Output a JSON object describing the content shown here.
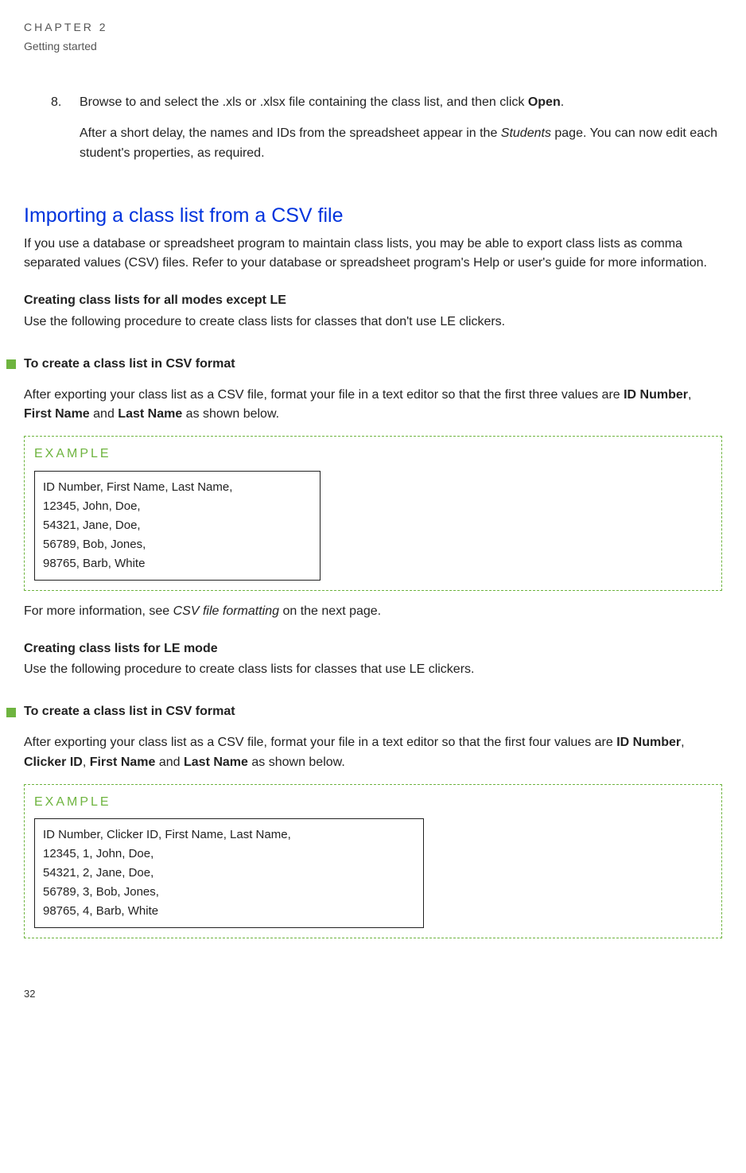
{
  "header": {
    "chapter": "CHAPTER 2",
    "subtitle": "Getting started"
  },
  "step8": {
    "number": "8.",
    "line1_pre": "Browse to and select the .xls or .xlsx file containing the class list, and then click ",
    "line1_bold": "Open",
    "line1_post": ".",
    "line2_pre": "After a short delay, the names and IDs from the spreadsheet appear in the ",
    "line2_italic": "Students",
    "line2_post": " page. You can now edit each student's properties, as required."
  },
  "section_title": "Importing a class list from a CSV file",
  "section_intro": "If you use a database or spreadsheet program to maintain class lists, you may be able to export class lists as comma separated values (CSV) files. Refer to your database or spreadsheet program's Help or user's guide for more information.",
  "sub1": {
    "title": "Creating class lists for all modes except LE",
    "body": "Use the following procedure to create class lists for classes that don't use LE clickers."
  },
  "proc1": {
    "title": "To create a class list in CSV format",
    "p_pre": "After exporting your class list as a CSV file, format your file in a text editor so that the first three values are ",
    "b1": "ID Number",
    "sep1": ", ",
    "b2": "First Name",
    "sep2": " and ",
    "b3": "Last Name",
    "p_post": " as shown below."
  },
  "example_label": "EXAMPLE",
  "example1_lines": [
    "ID Number, First Name, Last Name,",
    "12345, John, Doe,",
    "54321, Jane, Doe,",
    "56789, Bob, Jones,",
    "98765, Barb, White"
  ],
  "more_info_pre": "For more information, see ",
  "more_info_italic": "CSV file formatting",
  "more_info_post": " on the next page.",
  "sub2": {
    "title": "Creating class lists for LE mode",
    "body": "Use the following procedure to create class lists for classes that use LE clickers."
  },
  "proc2": {
    "title": "To create a class list in CSV format",
    "p_pre": "After exporting your class list as a CSV file, format your file in a text editor so that the first four values are ",
    "b1": "ID Number",
    "sep1": ", ",
    "b2": "Clicker ID",
    "sep2": ", ",
    "b3": "First Name",
    "sep3": " and ",
    "b4": "Last Name",
    "p_post": " as shown below."
  },
  "example2_lines": [
    "ID Number, Clicker ID, First Name, Last Name,",
    "12345, 1, John, Doe,",
    "54321, 2, Jane, Doe,",
    "56789, 3, Bob, Jones,",
    "98765, 4, Barb, White"
  ],
  "page_number": "32"
}
